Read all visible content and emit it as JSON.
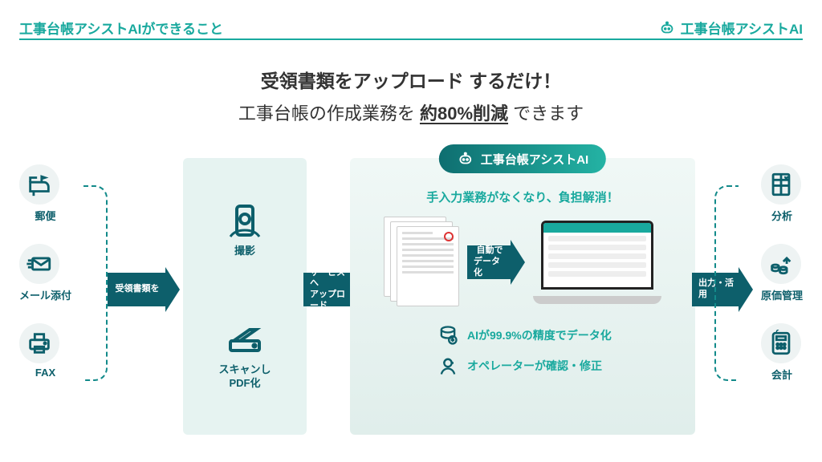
{
  "header": {
    "left": "工事台帳アシストAIができること",
    "right": "工事台帳アシストAI"
  },
  "headline": {
    "l1_bold": "受領書類をアップロード",
    "l1_rest": " するだけ！",
    "l2_pre": "工事台帳の作成業務を ",
    "l2_u": "約80%削減",
    "l2_post": " できます"
  },
  "inputs": [
    {
      "label": "郵便"
    },
    {
      "label": "メール添付"
    },
    {
      "label": "FAX"
    }
  ],
  "arrows": {
    "a1": "受領書類を",
    "a2_l1": "サービスへ",
    "a2_l2": "アップロード",
    "a3_l1": "自動で",
    "a3_l2": "データ化",
    "a4": "出力・活用"
  },
  "panel1": {
    "top": "撮影",
    "bottom_l1": "スキャンし",
    "bottom_l2": "PDF化"
  },
  "panel2": {
    "pill": "工事台帳アシストAI",
    "subtitle": "手入力業務がなくなり、負担解消！",
    "feat_ai": "AIが99.9%の精度でデータ化",
    "feat_op": "オペレーターが確認・修正"
  },
  "outputs": [
    {
      "label": "分析"
    },
    {
      "label": "原価管理"
    },
    {
      "label": "会計"
    }
  ]
}
